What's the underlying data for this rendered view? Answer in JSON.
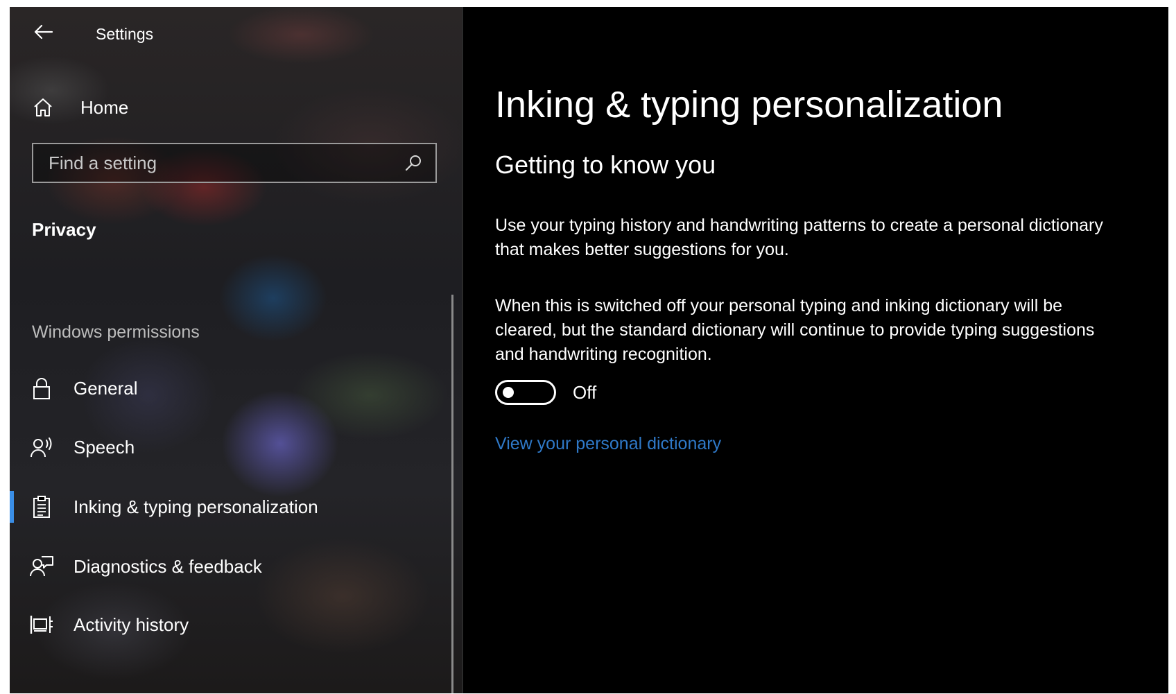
{
  "window": {
    "title": "Settings"
  },
  "sidebar": {
    "home_label": "Home",
    "search": {
      "placeholder": "Find a setting",
      "value": ""
    },
    "section_title": "Privacy",
    "group_title": "Windows permissions",
    "items": [
      {
        "label": "General",
        "icon": "lock-icon",
        "selected": false
      },
      {
        "label": "Speech",
        "icon": "speech-icon",
        "selected": false
      },
      {
        "label": "Inking & typing personalization",
        "icon": "inking-icon",
        "selected": true
      },
      {
        "label": "Diagnostics & feedback",
        "icon": "feedback-icon",
        "selected": false
      },
      {
        "label": "Activity history",
        "icon": "activity-icon",
        "selected": false
      }
    ]
  },
  "main": {
    "title": "Inking & typing personalization",
    "subheading": "Getting to know you",
    "description": "Use your typing history and handwriting patterns to create a personal dictionary that makes better suggestions for you.",
    "note": "When this is switched off your personal typing and inking dictionary will be cleared, but the standard dictionary will continue to provide typing suggestions and handwriting recognition.",
    "toggle": {
      "state_label": "Off",
      "on": false
    },
    "link_label": "View your personal dictionary"
  },
  "colors": {
    "accent": "#3a8ee6",
    "link": "#2f79c8",
    "background": "#000000",
    "text": "#ffffff"
  }
}
